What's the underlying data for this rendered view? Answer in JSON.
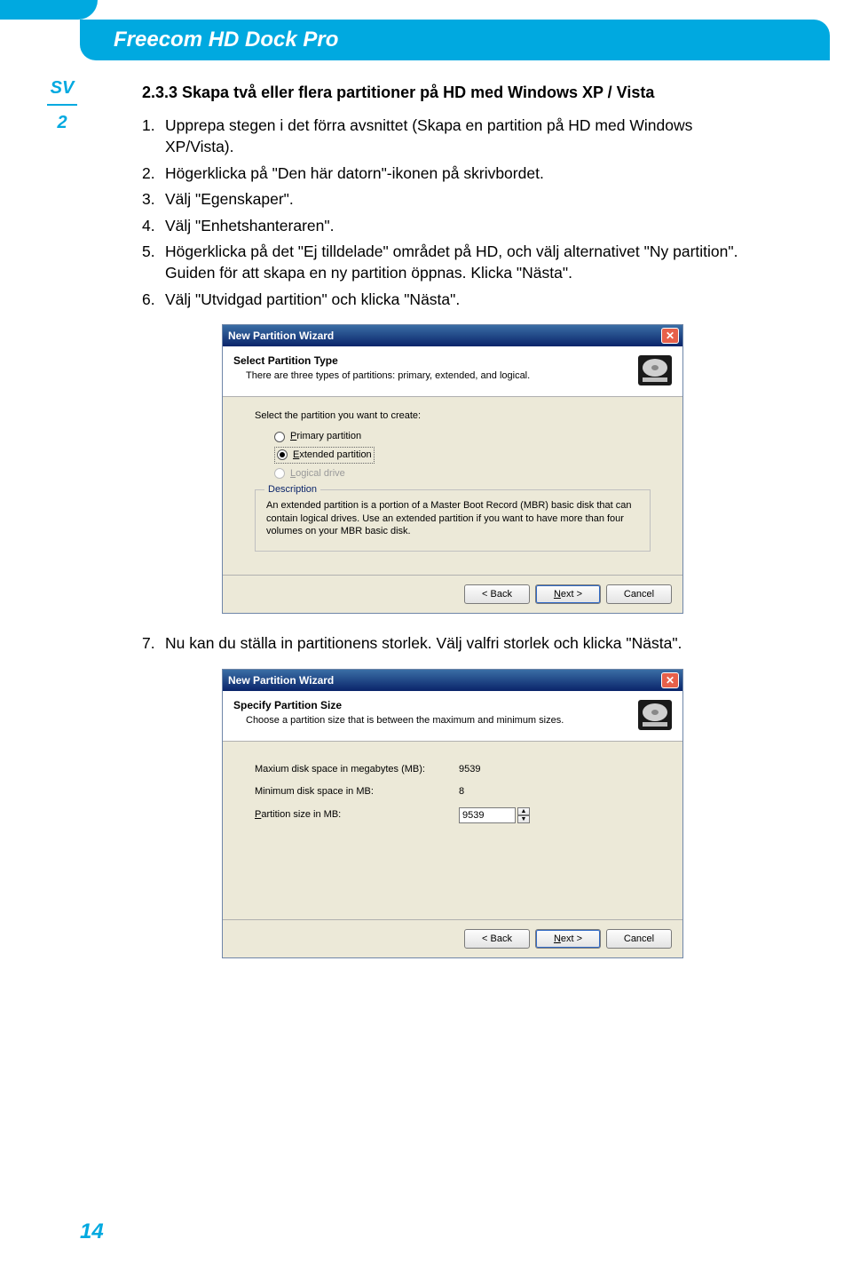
{
  "header": {
    "title": "Freecom HD Dock Pro"
  },
  "sidebar": {
    "lang": "SV",
    "chapter": "2"
  },
  "page_number": "14",
  "section": {
    "heading": "2.3.3 Skapa två eller flera partitioner på HD med Windows XP / Vista",
    "steps": [
      "Upprepa stegen i det förra avsnittet (Skapa en partition på HD med Windows XP/Vista).",
      "Högerklicka på \"Den här datorn\"-ikonen på skrivbordet.",
      "Välj \"Egenskaper\".",
      "Välj \"Enhetshanteraren\".",
      "Högerklicka på det \"Ej tilldelade\" området på HD, och välj alternativet \"Ny partition\". Guiden för att skapa en ny partition öppnas. Klicka \"Nästa\".",
      "Välj \"Utvidgad partition\" och klicka \"Nästa\"."
    ],
    "step7": "Nu kan du ställa in partitionens storlek. Välj valfri storlek och klicka \"Nästa\"."
  },
  "wizard1": {
    "title": "New Partition Wizard",
    "subtitle": "Select Partition Type",
    "desc": "There are three types of partitions: primary, extended, and logical.",
    "prompt": "Select the partition you want to create:",
    "opt_primary": "Primary partition",
    "opt_extended": "Extended partition",
    "opt_logical": "Logical drive",
    "group_legend": "Description",
    "group_text": "An extended partition is a portion of a Master Boot Record (MBR) basic disk that can contain logical drives. Use an extended partition if you want to have more than four volumes on your MBR basic disk.",
    "btn_back": "< Back",
    "btn_next": "Next >",
    "btn_cancel": "Cancel"
  },
  "wizard2": {
    "title": "New Partition Wizard",
    "subtitle": "Specify Partition Size",
    "desc": "Choose a partition size that is between the maximum and minimum sizes.",
    "lbl_max": "Maxium disk space in megabytes (MB):",
    "val_max": "9539",
    "lbl_min": "Minimum disk space in MB:",
    "val_min": "8",
    "lbl_size": "Partition size in MB:",
    "val_size": "9539",
    "btn_back": "< Back",
    "btn_next": "Next >",
    "btn_cancel": "Cancel"
  }
}
